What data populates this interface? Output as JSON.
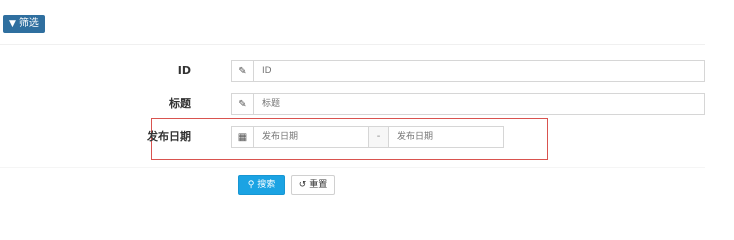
{
  "toolbar": {
    "filter_label": "筛选",
    "filter_icon": "filter-icon"
  },
  "form": {
    "id": {
      "label": "ID",
      "placeholder": "ID",
      "icon": "pencil-icon"
    },
    "title": {
      "label": "标题",
      "placeholder": "标题",
      "icon": "pencil-icon"
    },
    "publish_date": {
      "label": "发布日期",
      "icon": "calendar-icon",
      "start_placeholder": "发布日期",
      "separator": "-",
      "end_placeholder": "发布日期",
      "highlighted": true
    }
  },
  "actions": {
    "search_label": "搜索",
    "search_icon": "search-icon",
    "reset_label": "重置",
    "reset_icon": "undo-icon"
  },
  "colors": {
    "filter_button": "#2f6f9f",
    "search_button": "#1ba3e3",
    "highlight_border": "#d9534f"
  }
}
